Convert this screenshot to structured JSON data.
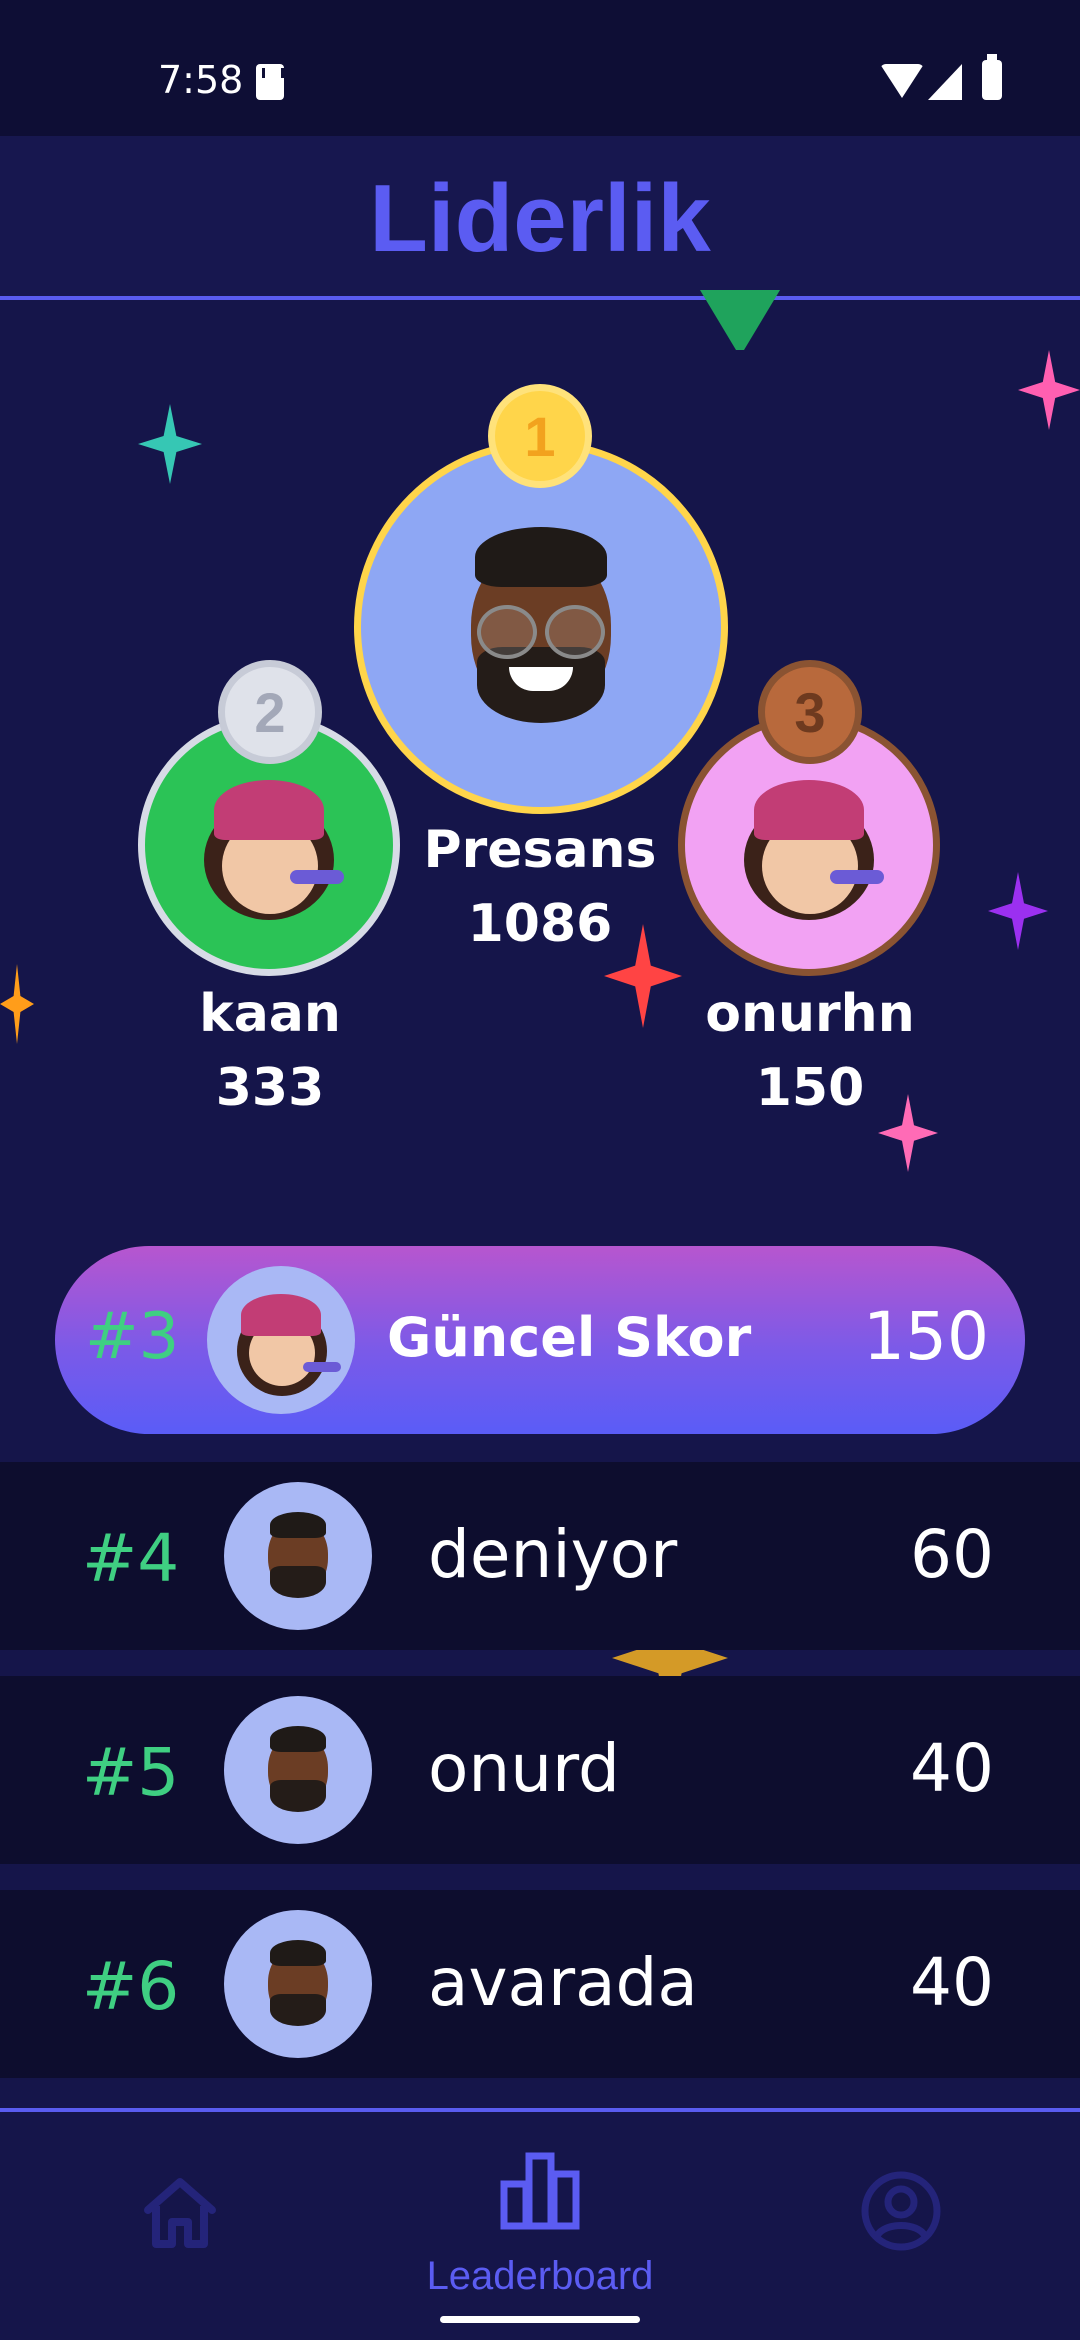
{
  "status_bar": {
    "time": "7:58"
  },
  "header": {
    "title": "Liderlik"
  },
  "podium": [
    {
      "rank": "1",
      "name": "Presans",
      "score": "1086",
      "ring_color": "#ffd54a",
      "bg_color": "#8ea7f4",
      "badge_color": "#ffd54a",
      "badge_text_color": "#f2a21e"
    },
    {
      "rank": "2",
      "name": "kaan",
      "score": "333",
      "ring_color": "#d7dbe6",
      "bg_color": "#2bc356",
      "badge_color": "#dfe2ea",
      "badge_text_color": "#a3a8b8"
    },
    {
      "rank": "3",
      "name": "onurhn",
      "score": "150",
      "ring_color": "#8a5332",
      "bg_color": "#f2a2f3",
      "badge_color": "#b8693c",
      "badge_text_color": "#6e3a1f"
    }
  ],
  "current": {
    "rank": "#3",
    "label": "Güncel Skor",
    "score": "150"
  },
  "list": [
    {
      "rank": "#4",
      "name": "deniyor",
      "score": "60"
    },
    {
      "rank": "#5",
      "name": "onurd",
      "score": "40"
    },
    {
      "rank": "#6",
      "name": "avarada",
      "score": "40"
    }
  ],
  "nav": {
    "items": [
      {
        "icon": "home-icon",
        "label": ""
      },
      {
        "icon": "leaderboard-icon",
        "label": "Leaderboard"
      },
      {
        "icon": "profile-icon",
        "label": ""
      }
    ],
    "active_index": 1,
    "accent": "#5b5cf2"
  },
  "colors": {
    "background": "#15154a",
    "rank_text": "#3fcf82",
    "row_background": "#0d0d2e"
  }
}
